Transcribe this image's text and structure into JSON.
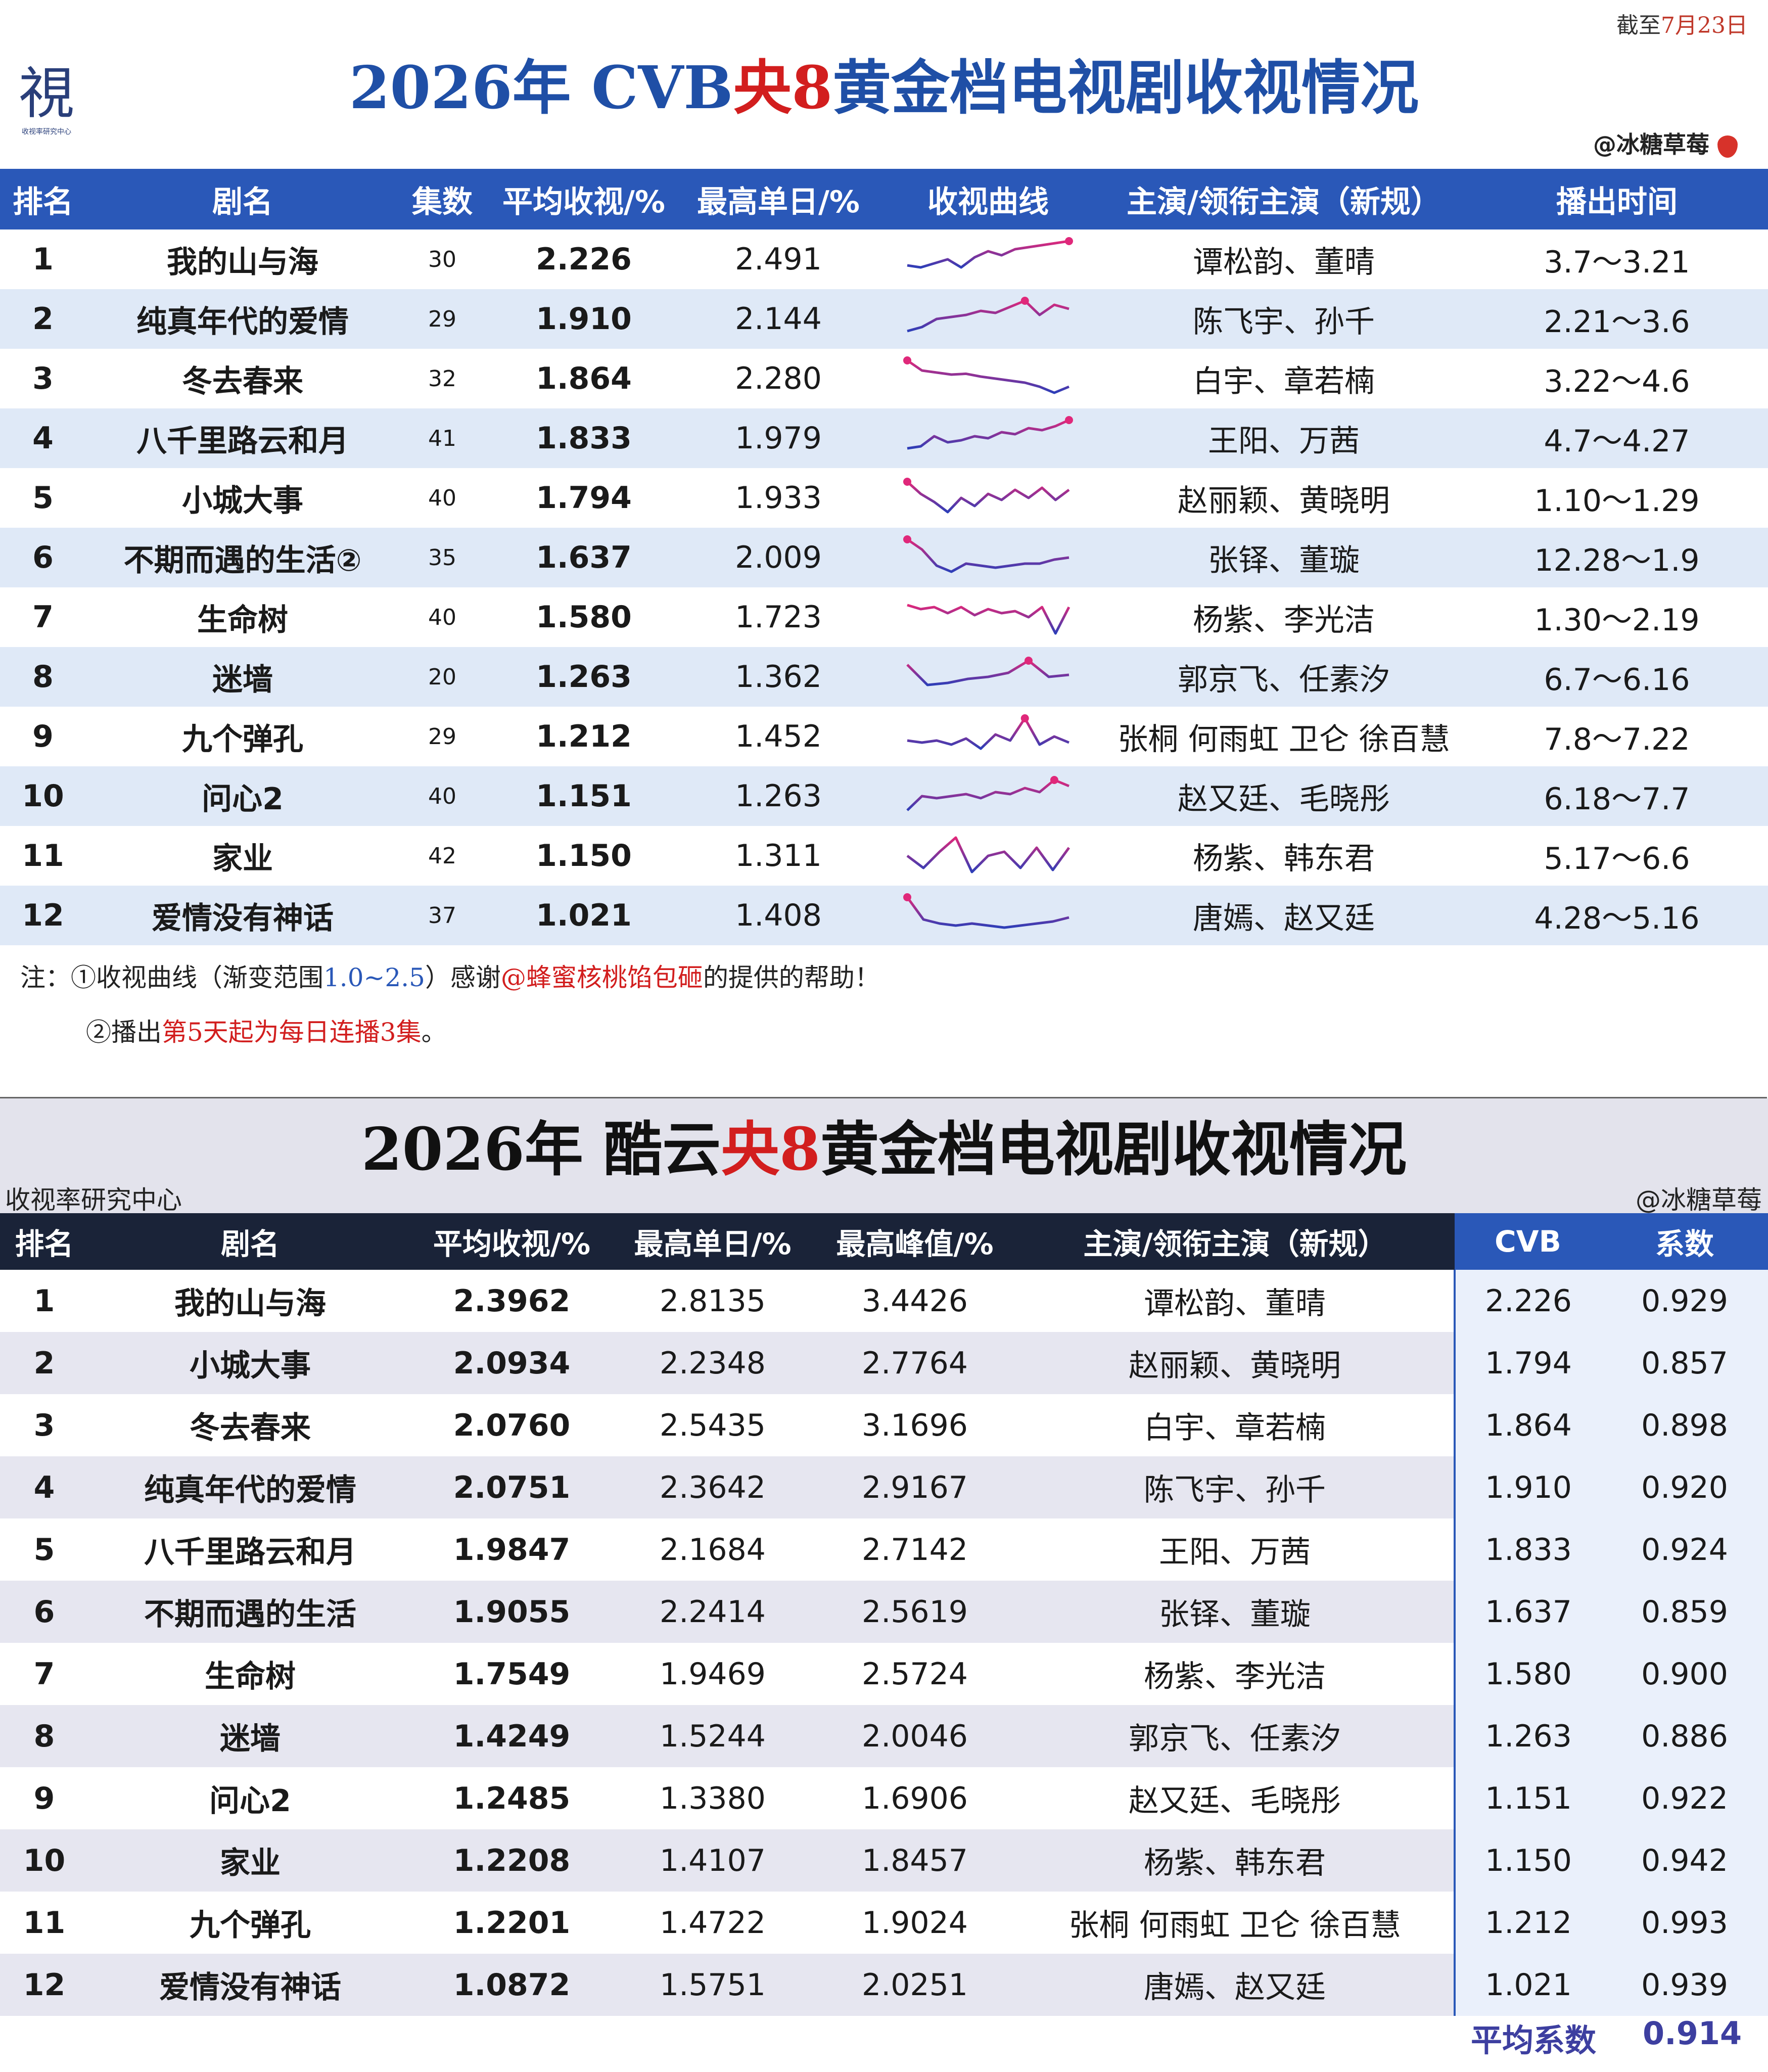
{
  "date_note": {
    "prefix": "截至",
    "date": "7月23日"
  },
  "logo": {
    "glyph": "視",
    "subtitle": "收视率研究中心"
  },
  "title1": {
    "pre": "2026年 CVB",
    "highlight": "央8",
    "post": "黄金档电视剧收视情况"
  },
  "credit1": "@冰糖草莓",
  "table1": {
    "headers": [
      "排名",
      "剧名",
      "集数",
      "平均收视/%",
      "最高单日/%",
      "收视曲线",
      "主演/领衔主演（新规）",
      "播出时间"
    ],
    "rows": [
      {
        "rank": "1",
        "title": "我的山与海",
        "episodes": "30",
        "avg": "2.226",
        "max": "2.491",
        "cast": "谭松韵、董晴",
        "time": "3.7～3.21"
      },
      {
        "rank": "2",
        "title": "纯真年代的爱情",
        "episodes": "29",
        "avg": "1.910",
        "max": "2.144",
        "cast": "陈飞宇、孙千",
        "time": "2.21～3.6"
      },
      {
        "rank": "3",
        "title": "冬去春来",
        "episodes": "32",
        "avg": "1.864",
        "max": "2.280",
        "cast": "白宇、章若楠",
        "time": "3.22～4.6"
      },
      {
        "rank": "4",
        "title": "八千里路云和月",
        "episodes": "41",
        "avg": "1.833",
        "max": "1.979",
        "cast": "王阳、万茜",
        "time": "4.7～4.27"
      },
      {
        "rank": "5",
        "title": "小城大事",
        "episodes": "40",
        "avg": "1.794",
        "max": "1.933",
        "cast": "赵丽颖、黄晓明",
        "time": "1.10～1.29"
      },
      {
        "rank": "6",
        "title": "不期而遇的生活②",
        "episodes": "35",
        "avg": "1.637",
        "max": "2.009",
        "cast": "张铎、董璇",
        "time": "12.28～1.9"
      },
      {
        "rank": "7",
        "title": "生命树",
        "episodes": "40",
        "avg": "1.580",
        "max": "1.723",
        "cast": "杨紫、李光洁",
        "time": "1.30～2.19"
      },
      {
        "rank": "8",
        "title": "迷墙",
        "episodes": "20",
        "avg": "1.263",
        "max": "1.362",
        "cast": "郭京飞、任素汐",
        "time": "6.7～6.16"
      },
      {
        "rank": "9",
        "title": "九个弹孔",
        "episodes": "29",
        "avg": "1.212",
        "max": "1.452",
        "cast": "张桐 何雨虹 卫仑 徐百慧",
        "time": "7.8～7.22"
      },
      {
        "rank": "10",
        "title": "问心2",
        "episodes": "40",
        "avg": "1.151",
        "max": "1.263",
        "cast": "赵又廷、毛晓彤",
        "time": "6.18～7.7"
      },
      {
        "rank": "11",
        "title": "家业",
        "episodes": "42",
        "avg": "1.150",
        "max": "1.311",
        "cast": "杨紫、韩东君",
        "time": "5.17～6.6"
      },
      {
        "rank": "12",
        "title": "爱情没有神话",
        "episodes": "37",
        "avg": "1.021",
        "max": "1.408",
        "cast": "唐嫣、赵又廷",
        "time": "4.28～5.16"
      }
    ]
  },
  "sparklines": [
    {
      "values": [
        0.35,
        0.3,
        0.4,
        0.5,
        0.3,
        0.55,
        0.7,
        0.6,
        0.75,
        0.8,
        0.85,
        0.9,
        0.95
      ],
      "end_marker": "end"
    },
    {
      "values": [
        0.2,
        0.3,
        0.5,
        0.55,
        0.6,
        0.7,
        0.65,
        0.8,
        0.95,
        0.6,
        0.85,
        0.75
      ],
      "end_marker": "peak"
    },
    {
      "values": [
        0.95,
        0.7,
        0.65,
        0.6,
        0.62,
        0.55,
        0.5,
        0.45,
        0.4,
        0.3,
        0.15,
        0.3
      ],
      "end_marker": "start"
    },
    {
      "values": [
        0.25,
        0.3,
        0.55,
        0.4,
        0.45,
        0.55,
        0.5,
        0.65,
        0.6,
        0.75,
        0.7,
        0.8,
        0.95
      ],
      "end_marker": "end"
    },
    {
      "values": [
        0.9,
        0.6,
        0.4,
        0.15,
        0.5,
        0.3,
        0.6,
        0.45,
        0.7,
        0.5,
        0.75,
        0.45,
        0.7
      ],
      "end_marker": "start"
    },
    {
      "values": [
        0.95,
        0.7,
        0.3,
        0.15,
        0.35,
        0.3,
        0.25,
        0.3,
        0.35,
        0.35,
        0.45,
        0.5
      ],
      "end_marker": "start"
    },
    {
      "values": [
        0.8,
        0.7,
        0.75,
        0.6,
        0.75,
        0.55,
        0.7,
        0.6,
        0.65,
        0.5,
        0.75,
        0.1,
        0.75
      ],
      "end_marker": "none"
    },
    {
      "values": [
        0.8,
        0.3,
        0.35,
        0.45,
        0.5,
        0.6,
        0.9,
        0.5,
        0.55
      ],
      "end_marker": "peak"
    },
    {
      "values": [
        0.4,
        0.35,
        0.4,
        0.3,
        0.45,
        0.2,
        0.55,
        0.4,
        0.95,
        0.3,
        0.5,
        0.35
      ],
      "end_marker": "peak"
    },
    {
      "values": [
        0.15,
        0.5,
        0.45,
        0.5,
        0.55,
        0.45,
        0.6,
        0.55,
        0.7,
        0.6,
        0.9,
        0.75
      ],
      "end_marker": "peak"
    },
    {
      "values": [
        0.5,
        0.2,
        0.6,
        0.95,
        0.1,
        0.5,
        0.6,
        0.2,
        0.7,
        0.15,
        0.7
      ],
      "end_marker": "none"
    },
    {
      "values": [
        0.95,
        0.4,
        0.3,
        0.25,
        0.3,
        0.25,
        0.2,
        0.25,
        0.3,
        0.35,
        0.45
      ],
      "end_marker": "start"
    }
  ],
  "notes": {
    "note1_pre": "注：①收视曲线（渐变范围",
    "note1_range": "1.0~2.5",
    "note1_mid": "）感谢",
    "note1_thanks": "@蜂蜜核桃馅包砸",
    "note1_post": "的提供的帮助！",
    "note2_pre": "②播出",
    "note2_red": "第5天起为每日连播3集",
    "note2_post": "。"
  },
  "title2": {
    "pre": "2026年 酷云",
    "highlight": "央8",
    "post": "黄金档电视剧收视情况"
  },
  "source2": "收视率研究中心",
  "credit2": "@冰糖草莓",
  "table2": {
    "headers": [
      "排名",
      "剧名",
      "平均收视/%",
      "最高单日/%",
      "最高峰值/%",
      "主演/领衔主演（新规）",
      "CVB",
      "系数"
    ],
    "rows": [
      {
        "rank": "1",
        "title": "我的山与海",
        "avg": "2.3962",
        "max_day": "2.8135",
        "peak": "3.4426",
        "cast": "谭松韵、董晴",
        "cvb": "2.226",
        "coef": "0.929"
      },
      {
        "rank": "2",
        "title": "小城大事",
        "avg": "2.0934",
        "max_day": "2.2348",
        "peak": "2.7764",
        "cast": "赵丽颖、黄晓明",
        "cvb": "1.794",
        "coef": "0.857"
      },
      {
        "rank": "3",
        "title": "冬去春来",
        "avg": "2.0760",
        "max_day": "2.5435",
        "peak": "3.1696",
        "cast": "白宇、章若楠",
        "cvb": "1.864",
        "coef": "0.898"
      },
      {
        "rank": "4",
        "title": "纯真年代的爱情",
        "avg": "2.0751",
        "max_day": "2.3642",
        "peak": "2.9167",
        "cast": "陈飞宇、孙千",
        "cvb": "1.910",
        "coef": "0.920"
      },
      {
        "rank": "5",
        "title": "八千里路云和月",
        "avg": "1.9847",
        "max_day": "2.1684",
        "peak": "2.7142",
        "cast": "王阳、万茜",
        "cvb": "1.833",
        "coef": "0.924"
      },
      {
        "rank": "6",
        "title": "不期而遇的生活",
        "avg": "1.9055",
        "max_day": "2.2414",
        "peak": "2.5619",
        "cast": "张铎、董璇",
        "cvb": "1.637",
        "coef": "0.859"
      },
      {
        "rank": "7",
        "title": "生命树",
        "avg": "1.7549",
        "max_day": "1.9469",
        "peak": "2.5724",
        "cast": "杨紫、李光洁",
        "cvb": "1.580",
        "coef": "0.900"
      },
      {
        "rank": "8",
        "title": "迷墙",
        "avg": "1.4249",
        "max_day": "1.5244",
        "peak": "2.0046",
        "cast": "郭京飞、任素汐",
        "cvb": "1.263",
        "coef": "0.886"
      },
      {
        "rank": "9",
        "title": "问心2",
        "avg": "1.2485",
        "max_day": "1.3380",
        "peak": "1.6906",
        "cast": "赵又廷、毛晓彤",
        "cvb": "1.151",
        "coef": "0.922"
      },
      {
        "rank": "10",
        "title": "家业",
        "avg": "1.2208",
        "max_day": "1.4107",
        "peak": "1.8457",
        "cast": "杨紫、韩东君",
        "cvb": "1.150",
        "coef": "0.942"
      },
      {
        "rank": "11",
        "title": "九个弹孔",
        "avg": "1.2201",
        "max_day": "1.4722",
        "peak": "1.9024",
        "cast": "张桐 何雨虹 卫仑 徐百慧",
        "cvb": "1.212",
        "coef": "0.993"
      },
      {
        "rank": "12",
        "title": "爱情没有神话",
        "avg": "1.0872",
        "max_day": "1.5751",
        "peak": "2.0251",
        "cast": "唐嫣、赵又廷",
        "cvb": "1.021",
        "coef": "0.939"
      }
    ],
    "avg_coef_label": "平均系数",
    "avg_coef_value": "0.914"
  },
  "colors": {
    "title_blue": "#1f4fa6",
    "accent_red": "#d21e1e",
    "header_blue": "#2a58b8",
    "header_dark": "#1a2338",
    "row_tint": "#dfe9f7",
    "curve_start": "#2c3eb8",
    "curve_end": "#e0287a"
  }
}
